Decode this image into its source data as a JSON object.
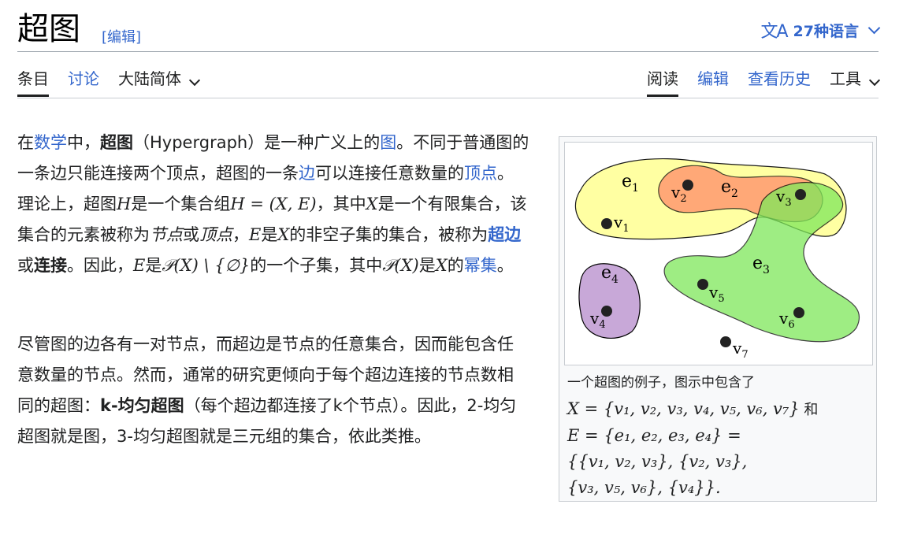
{
  "header": {
    "title": "超图",
    "edit_link": "[编辑]",
    "languages_label": "27种语言",
    "languages_icon": "translate-icon"
  },
  "tabs_left": [
    {
      "label": "条目"
    },
    {
      "label": "讨论"
    },
    {
      "label": "大陆简体"
    }
  ],
  "tabs_right": [
    {
      "label": "阅读"
    },
    {
      "label": "编辑"
    },
    {
      "label": "查看历史"
    },
    {
      "label": "工具"
    }
  ],
  "article": {
    "p1": {
      "t1": "在",
      "l1": "数学",
      "t2": "中，",
      "b1": "超图",
      "t3": "（Hypergraph）是一种广义上的",
      "l2": "图",
      "t4": "。不同于普通图的一条边只能连接两个顶点，超图的一条",
      "l3": "边",
      "t5": "可以连接任意数量的",
      "l4": "顶点",
      "t6": "。理论上，超图",
      "m1": "H",
      "t7": "是一个集合组",
      "m2": "H = (X, E)",
      "t8": "，其中",
      "m3": "X",
      "t9": "是一个有限集合，该集合的元素被称为",
      "i1": "节点",
      "t10": "或",
      "i2": "顶点",
      "t11": "，",
      "m4": "E",
      "t12": "是",
      "m5": "X",
      "t13": "的非空子集的集合，被称为",
      "lb1": "超边",
      "t14": "或",
      "b2": "连接",
      "t15": "。因此，",
      "m6": "E",
      "t16": "是",
      "m7": "𝒫(X) \\ {∅}",
      "t17": "的一个子集，其中",
      "m8": "𝒫(X)",
      "t18": "是",
      "m9": "X",
      "t19": "的",
      "l5": "幂集",
      "t20": "。"
    },
    "p2": {
      "t1": "尽管图的边各有一对节点，而超边是节点的任意集合，因而能包含任意数量的节点。然而，通常的研究更倾向于每个超边连接的节点数相同的超图：",
      "b1": "k-均匀超图",
      "t2": "（每个超边都连接了k个节点）。因此，2-均匀超图就是图，3-均匀超图就是三元组的集合，依此类推。"
    }
  },
  "figure": {
    "edges": [
      {
        "label": "e",
        "sub": "1",
        "color": "#ffff99"
      },
      {
        "label": "e",
        "sub": "2",
        "color": "#ff8c69"
      },
      {
        "label": "e",
        "sub": "3",
        "color": "#90ee70"
      },
      {
        "label": "e",
        "sub": "4",
        "color": "#c8a8d8"
      }
    ],
    "vertices": [
      {
        "label": "v",
        "sub": "1"
      },
      {
        "label": "v",
        "sub": "2"
      },
      {
        "label": "v",
        "sub": "3"
      },
      {
        "label": "v",
        "sub": "4"
      },
      {
        "label": "v",
        "sub": "5"
      },
      {
        "label": "v",
        "sub": "6"
      },
      {
        "label": "v",
        "sub": "7"
      }
    ],
    "caption_text": "一个超图的例子，图示中包含了",
    "caption_line1": "X = {v₁, v₂, v₃, v₄, v₅, v₆, v₇}",
    "caption_and": " 和",
    "caption_line2": "E = {e₁, e₂, e₃, e₄} =",
    "caption_line3": "{{v₁, v₂, v₃}, {v₂, v₃},",
    "caption_line4": "{v₃, v₅, v₆}, {v₄}}."
  }
}
